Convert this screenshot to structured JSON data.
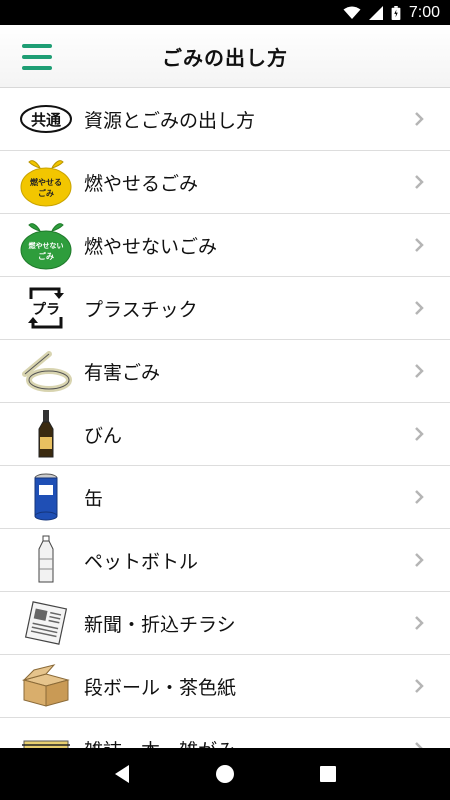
{
  "status_bar": {
    "time": "7:00",
    "icons": [
      "wifi-icon",
      "signal-icon",
      "battery-icon"
    ]
  },
  "app_bar": {
    "title": "ごみの出し方",
    "menu_icon": "hamburger-menu-icon"
  },
  "menu_items": [
    {
      "label": "資源とごみの出し方",
      "icon": "common-badge-icon",
      "badge_text": "共通"
    },
    {
      "label": "燃やせるごみ",
      "icon": "yellow-burnable-bag-icon",
      "badge_text": "燃やせるごみ"
    },
    {
      "label": "燃やせないごみ",
      "icon": "green-nonburnable-bag-icon",
      "badge_text": "燃やせないごみ"
    },
    {
      "label": "プラスチック",
      "icon": "plastic-recycle-mark-icon",
      "badge_text": "プラ"
    },
    {
      "label": "有害ごみ",
      "icon": "fluorescent-tube-icon"
    },
    {
      "label": "びん",
      "icon": "glass-bottle-icon"
    },
    {
      "label": "缶",
      "icon": "can-icon"
    },
    {
      "label": "ペットボトル",
      "icon": "pet-bottle-icon"
    },
    {
      "label": "新聞・折込チラシ",
      "icon": "newspaper-icon"
    },
    {
      "label": "段ボール・茶色紙",
      "icon": "cardboard-box-icon"
    },
    {
      "label": "雑誌・本・雑がみ",
      "icon": "magazine-stack-icon"
    }
  ],
  "colors": {
    "accent": "#1e9e74",
    "yellow_bag": "#f2c600",
    "green_bag": "#2e9d3c",
    "divider": "#dddddd",
    "chevron": "#b5b5b5"
  },
  "nav_bar": {
    "icons": [
      "back-icon",
      "home-icon",
      "recents-icon"
    ]
  }
}
